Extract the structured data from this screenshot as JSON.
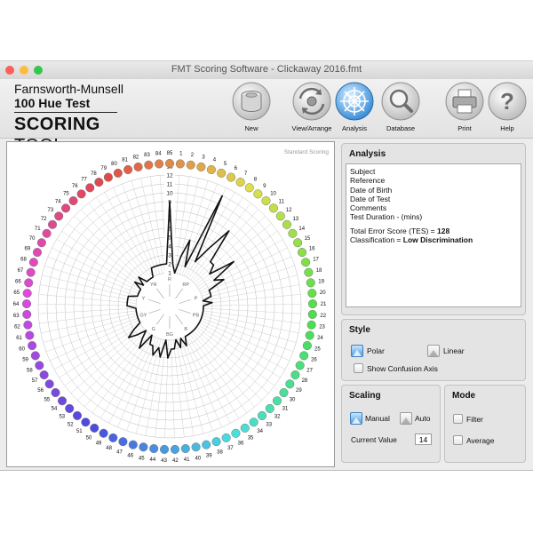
{
  "window": {
    "title": "FMT Scoring Software - Clickaway 2016.fmt",
    "traffic_colors": [
      "#fc605c",
      "#fdbc40",
      "#34c84a"
    ]
  },
  "logo": {
    "line1": "Farnsworth-Munsell",
    "line2": "100 Hue Test",
    "tool_bold": "SCORING",
    "tool_light": " TOOL"
  },
  "toolbar": {
    "new_label": "New",
    "view_arrange_label": "View/Arrange",
    "analysis_label": "Analysis",
    "database_label": "Database",
    "print_label": "Print",
    "help_label": "Help"
  },
  "plot": {
    "watermark": "Standard Scoring",
    "scale_labels": [
      "1",
      "2",
      "3",
      "4",
      "5",
      "6",
      "7",
      "8",
      "9",
      "10",
      "11",
      "12",
      "13"
    ],
    "inner_labels": [
      "R",
      "RP",
      "P",
      "PB",
      "B",
      "BG",
      "G",
      "GY",
      "Y",
      "YR"
    ],
    "caps": [
      "85",
      "1",
      "2",
      "3",
      "4",
      "5",
      "6",
      "7",
      "8",
      "9",
      "10",
      "11",
      "12",
      "13",
      "14",
      "15",
      "16",
      "17",
      "18",
      "19",
      "20",
      "21",
      "22",
      "23",
      "24",
      "25",
      "26",
      "27",
      "28",
      "29",
      "30",
      "31",
      "32",
      "33",
      "34",
      "35",
      "36",
      "37",
      "38",
      "39",
      "40",
      "41",
      "42",
      "43",
      "44",
      "45",
      "46",
      "47",
      "48",
      "49",
      "50",
      "51",
      "52",
      "53",
      "54",
      "55",
      "56",
      "57",
      "58",
      "59",
      "60",
      "61",
      "62",
      "63",
      "64",
      "65",
      "66",
      "67",
      "68",
      "69",
      "70",
      "71",
      "72",
      "73",
      "74",
      "75",
      "76",
      "77",
      "78",
      "79",
      "80",
      "81",
      "82",
      "83",
      "84"
    ]
  },
  "chart_data": {
    "type": "polar",
    "title": "",
    "categories": [
      "85",
      "1",
      "2",
      "3",
      "4",
      "5",
      "6",
      "7",
      "8",
      "9",
      "10",
      "11",
      "12",
      "13",
      "14",
      "15",
      "16",
      "17",
      "18",
      "19",
      "20",
      "21",
      "22",
      "23",
      "24",
      "25",
      "26",
      "27",
      "28",
      "29",
      "30",
      "31",
      "32",
      "33",
      "34",
      "35",
      "36",
      "37",
      "38",
      "39",
      "40",
      "41",
      "42",
      "43",
      "44",
      "45",
      "46",
      "47",
      "48",
      "49",
      "50",
      "51",
      "52",
      "53",
      "54",
      "55",
      "56",
      "57",
      "58",
      "59",
      "60",
      "61",
      "62",
      "63",
      "64",
      "65",
      "66",
      "67",
      "68",
      "69",
      "70",
      "71",
      "72",
      "73",
      "74",
      "75",
      "76",
      "77",
      "78",
      "79",
      "80",
      "81",
      "82",
      "83",
      "84"
    ],
    "values": [
      10,
      3,
      2,
      4,
      6,
      3,
      12,
      4,
      6,
      9,
      5,
      5,
      4,
      7,
      4,
      5,
      3,
      3,
      3,
      2,
      3,
      2,
      2,
      2,
      2,
      2,
      2,
      2,
      2,
      2,
      2,
      2,
      2,
      2,
      2,
      2,
      2,
      3,
      2,
      3,
      2,
      3,
      3,
      4,
      2,
      4,
      3,
      4,
      3,
      3,
      2,
      4,
      3,
      2,
      3,
      4,
      3,
      2,
      2,
      2,
      2,
      2,
      2,
      2,
      3,
      3,
      3,
      3,
      2,
      2,
      2,
      2,
      3,
      2,
      3,
      2,
      2,
      2,
      2,
      3,
      3,
      3,
      3,
      3,
      3
    ],
    "r_range": [
      2,
      13
    ],
    "scale": "linear",
    "grid": true
  },
  "analysis": {
    "title": "Analysis",
    "subject": "Subject",
    "reference": "Reference",
    "dob": "Date of Birth",
    "date_of_test": "Date of Test",
    "comments": "Comments",
    "duration": "Test Duration - (mins)",
    "tes_label": "Total Error Score (TES) = ",
    "tes_value": "128",
    "class_label": "Classification = ",
    "class_value": "Low Discrimination"
  },
  "style": {
    "title": "Style",
    "polar_label": "Polar",
    "linear_label": "Linear",
    "confusion_label": "Show Confusion Axis",
    "selected": "polar"
  },
  "scaling": {
    "title": "Scaling",
    "manual_label": "Manual",
    "auto_label": "Auto",
    "current_label": "Current Value",
    "current_value": "14",
    "selected": "manual"
  },
  "mode": {
    "title": "Mode",
    "filter_label": "Filter",
    "average_label": "Average"
  }
}
